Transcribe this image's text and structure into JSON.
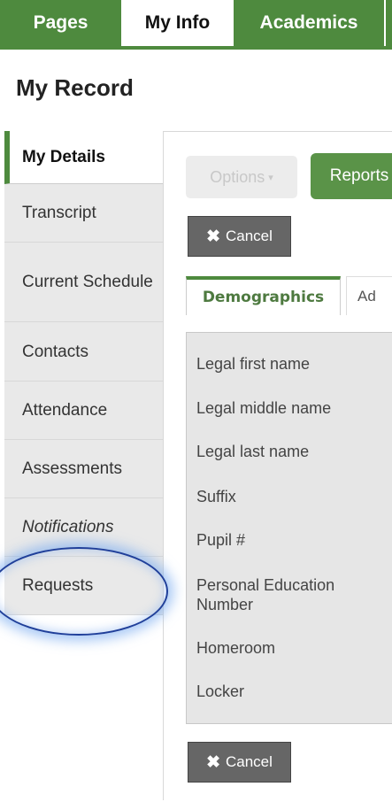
{
  "top_nav": {
    "tabs": [
      {
        "label": "Pages"
      },
      {
        "label": "My Info"
      },
      {
        "label": "Academics"
      }
    ]
  },
  "page_title": "My Record",
  "sidebar": {
    "items": [
      {
        "label": "My Details"
      },
      {
        "label": "Transcript"
      },
      {
        "label": "Current Schedule"
      },
      {
        "label": "Contacts"
      },
      {
        "label": "Attendance"
      },
      {
        "label": "Assessments"
      },
      {
        "label": "Notifications"
      },
      {
        "label": "Requests"
      }
    ]
  },
  "toolbar": {
    "options_label": "Options",
    "reports_label": "Reports",
    "cancel_label": "Cancel"
  },
  "subtabs": {
    "active_label": "Demographics",
    "next_label": "Ad"
  },
  "form": {
    "fields": [
      "Legal first name",
      "Legal middle name",
      "Legal last name",
      "Suffix",
      "Pupil #",
      "Personal Education Number",
      "Homeroom",
      "Locker"
    ]
  },
  "colors": {
    "brand_green": "#4e8a3e",
    "highlight_ring": "#1f3f9a"
  }
}
